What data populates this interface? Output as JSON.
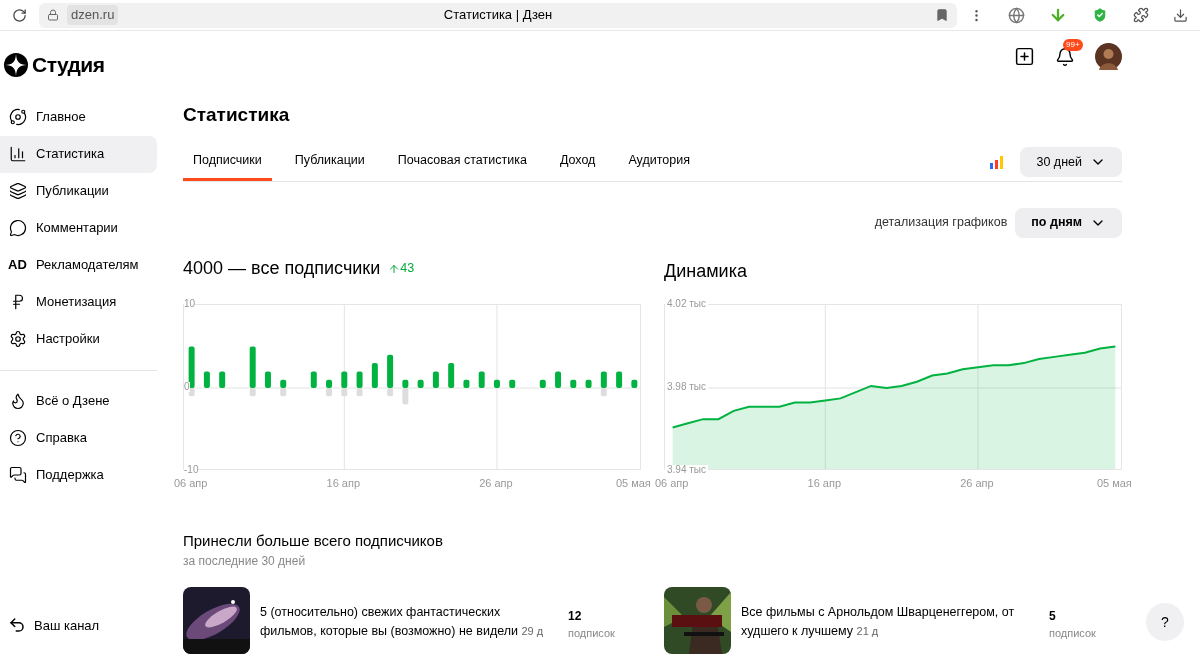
{
  "browser": {
    "url": "dzen.ru",
    "tab_title": "Статистика | Дзен"
  },
  "logo": "Студия",
  "header": {
    "notifications_badge": "99+"
  },
  "sidebar": {
    "groups": [
      [
        {
          "label": "Главное",
          "selected": false
        },
        {
          "label": "Статистика",
          "selected": true
        },
        {
          "label": "Публикации",
          "selected": false
        },
        {
          "label": "Комментарии",
          "selected": false
        },
        {
          "label": "Рекламодателям",
          "icon_text": "AD",
          "selected": false
        },
        {
          "label": "Монетизация",
          "selected": false
        },
        {
          "label": "Настройки",
          "selected": false
        }
      ],
      [
        {
          "label": "Всё о Дзене",
          "selected": false
        },
        {
          "label": "Справка",
          "selected": false
        },
        {
          "label": "Поддержка",
          "selected": false
        }
      ]
    ],
    "footer": {
      "label": "Ваш канал"
    }
  },
  "page_title": "Статистика",
  "tabs": [
    {
      "label": "Подписчики",
      "selected": true
    },
    {
      "label": "Публикации",
      "selected": false
    },
    {
      "label": "Почасовая статистика",
      "selected": false
    },
    {
      "label": "Доход",
      "selected": false
    },
    {
      "label": "Аудитория",
      "selected": false
    }
  ],
  "period": "30 дней",
  "detail": {
    "label": "детализация графиков",
    "value": "по дням"
  },
  "charts": [
    {
      "title": "4000 — все подписчики",
      "delta": "43",
      "chart_data": {
        "type": "bar",
        "grid": true,
        "categories": [
          "06 апр",
          null,
          null,
          null,
          null,
          null,
          null,
          null,
          null,
          null,
          "16 апр",
          null,
          null,
          null,
          null,
          null,
          null,
          null,
          null,
          null,
          "26 апр",
          null,
          null,
          null,
          null,
          null,
          null,
          null,
          null,
          "05 мая"
        ],
        "series": [
          {
            "color": "#00b341",
            "values": [
              5,
              2,
              2,
              0,
              5,
              2,
              1,
              0,
              2,
              1,
              2,
              2,
              3,
              4,
              1,
              1,
              2,
              3,
              1,
              2,
              1,
              1,
              0,
              1,
              2,
              1,
              1,
              2,
              2,
              1
            ]
          },
          {
            "color": "#dddddd",
            "values": [
              -1,
              0,
              0,
              0,
              -1,
              0,
              -1,
              0,
              0,
              -1,
              -1,
              -1,
              0,
              -1,
              -2,
              0,
              0,
              0,
              0,
              0,
              0,
              0,
              0,
              0,
              0,
              0,
              0,
              -1,
              0,
              0
            ]
          }
        ],
        "ylim": [
          -10,
          10
        ],
        "yticks": [
          10,
          0,
          -10
        ]
      }
    },
    {
      "title": "Динамика",
      "chart_data": {
        "type": "area",
        "grid": true,
        "categories": [
          "06 апр",
          null,
          null,
          null,
          null,
          null,
          null,
          null,
          null,
          null,
          "16 апр",
          null,
          null,
          null,
          null,
          null,
          null,
          null,
          null,
          null,
          "26 апр",
          null,
          null,
          null,
          null,
          null,
          null,
          null,
          null,
          "05 мая"
        ],
        "series": [
          {
            "color": "#00b341",
            "values": [
              3.961,
              3.963,
              3.965,
              3.965,
              3.969,
              3.971,
              3.971,
              3.971,
              3.973,
              3.973,
              3.974,
              3.975,
              3.978,
              3.981,
              3.98,
              3.981,
              3.983,
              3.986,
              3.987,
              3.989,
              3.99,
              3.991,
              3.991,
              3.992,
              3.994,
              3.995,
              3.996,
              3.997,
              3.999,
              4.0
            ]
          }
        ],
        "ylim": [
          3.94,
          4.02
        ],
        "yticks": [
          {
            "value": 4.02,
            "label": "4.02 тыс"
          },
          {
            "value": 3.98,
            "label": "3.98 тыс"
          },
          {
            "value": 3.94,
            "label": "3.94 тыс"
          }
        ]
      }
    }
  ],
  "top": {
    "title": "Принесли больше всего подписчиков",
    "subtitle": "за последние 30 дней",
    "items": [
      {
        "kind": "picture",
        "title": "5 (относительно) свежих фантастических фильмов, которые вы (возможно) не видели",
        "age": "29 д",
        "count": "12",
        "unit": "подписок"
      },
      {
        "kind": "picture",
        "title": "Все фильмы с Арнольдом Шварценеггером, от худшего к лучшему",
        "age": "21 д",
        "count": "5",
        "unit": "подписок"
      }
    ]
  },
  "help_button": "?"
}
